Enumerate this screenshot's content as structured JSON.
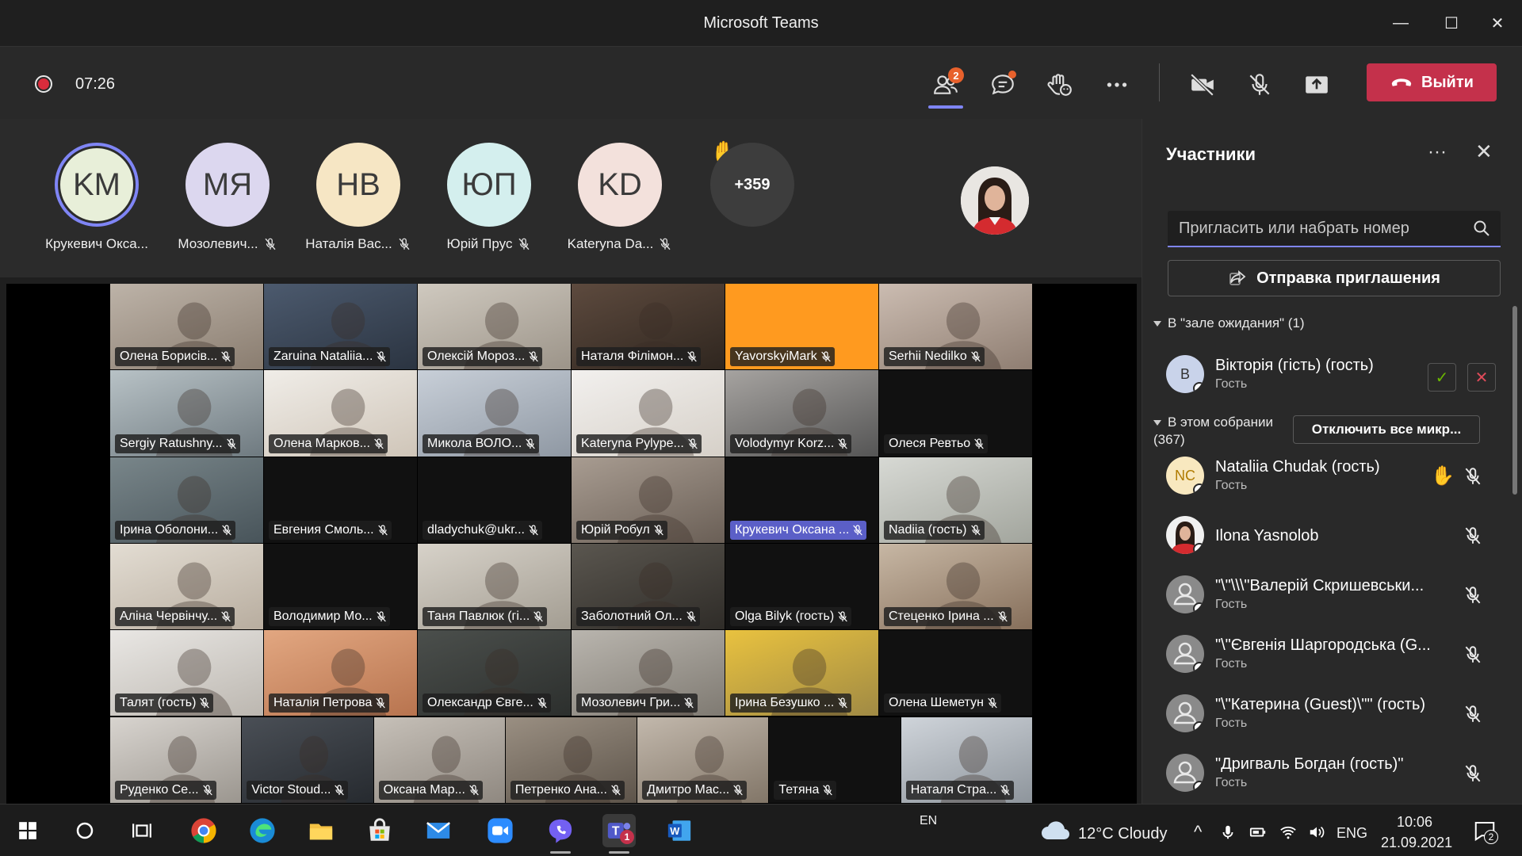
{
  "window": {
    "title": "Microsoft Teams",
    "minimize": "—",
    "maximize": "☐",
    "close": "✕"
  },
  "toolbar": {
    "timer": "07:26",
    "participants_badge": "2",
    "leave_label": "Выйти"
  },
  "stage": {
    "avatars": [
      {
        "initials": "KM",
        "name": "Крукевич Окса...",
        "color": "#e8efd9",
        "ring": true,
        "muted": false
      },
      {
        "initials": "МЯ",
        "name": "Мозолевич...",
        "color": "#dcd7ef",
        "ring": false,
        "muted": true
      },
      {
        "initials": "НВ",
        "name": "Наталія Вас...",
        "color": "#f6e6c4",
        "ring": false,
        "muted": true
      },
      {
        "initials": "ЮП",
        "name": "Юрій Прус",
        "color": "#d4efee",
        "ring": false,
        "muted": true
      },
      {
        "initials": "KD",
        "name": "Kateryna Da...",
        "color": "#f3e1dc",
        "ring": false,
        "muted": true
      }
    ],
    "more_count": "+359",
    "tiles": [
      [
        "Олена Борисів...",
        "Zaruina Nataliia...",
        "Олексій Мороз...",
        "Наталя Філімон...",
        "YavorskyiMark",
        "Serhii Nedilko"
      ],
      [
        "Sergiy Ratushny...",
        "Олена Марков...",
        "Микола ВОЛО...",
        "Kateryna Pylype...",
        "Volodymyr Korz...",
        "Олеся Ревтьо"
      ],
      [
        "Ірина Оболони...",
        "Евгения Смоль...",
        "dladychuk@ukr...",
        "Юрій Робул",
        "Крукевич Оксана ...",
        "Nadiia (гость)"
      ],
      [
        "Аліна Червінчу...",
        "Володимир Мо...",
        "Таня Павлюк (гі...",
        "Заболотний Ол...",
        "Olga Bilyk (гость)",
        "Стеценко Ірина ..."
      ],
      [
        "Талят (гость)",
        "Наталія Петрова",
        "Олександр Євге...",
        "Мозолевич Гри...",
        "Ірина Безушко ...",
        "Олена Шеметун"
      ],
      [
        "Руденко Се...",
        "Victor Stoud...",
        "Оксана Мар...",
        "Петренко Ана...",
        "Дмитро Мас...",
        "Тетяна",
        "Наталя Стра..."
      ]
    ]
  },
  "panel": {
    "title": "Участники",
    "more": "···",
    "close": "✕",
    "search_placeholder": "Пригласить или набрать номер",
    "invite_label": "Отправка приглашения",
    "waiting_section": "В \"зале ожидания\" (1)",
    "meeting_section_line1": "В этом собрании",
    "meeting_section_line2": "(367)",
    "mute_all_label": "Отключить все микр...",
    "waiting": [
      {
        "initials": "В",
        "name": "Вікторія (гість) (гость)",
        "role": "Гость"
      }
    ],
    "participants": [
      {
        "initials": "NC",
        "name": "Nataliia Chudak (гость)",
        "role": "Гость",
        "hand": true,
        "color": "#f8e8bf"
      },
      {
        "initials": "",
        "name": "Ilona Yasnolob",
        "role": "",
        "hand": false,
        "color": "#f0f0f0"
      },
      {
        "initials": "",
        "name": "\"\\\"\\\\\\\"Валерій Скришевськи...",
        "role": "Гость",
        "hand": false,
        "color": "#8a8a8a"
      },
      {
        "initials": "",
        "name": "\"\\\"Євгенія Шаргородська (G...",
        "role": "Гость",
        "hand": false,
        "color": "#8a8a8a"
      },
      {
        "initials": "",
        "name": "\"\\\"Катерина (Guest)\\\"\" (гость)",
        "role": "Гость",
        "hand": false,
        "color": "#8a8a8a"
      },
      {
        "initials": "",
        "name": "\"Дригваль Богдан (гость)\"",
        "role": "Гость",
        "hand": false,
        "color": "#8a8a8a"
      }
    ]
  },
  "taskbar": {
    "weather": "12°C  Cloudy",
    "lang_top": "EN",
    "lang": "ENG",
    "time": "10:06",
    "date": "21.09.2021",
    "notifications": "2",
    "teams_badge": "1"
  }
}
